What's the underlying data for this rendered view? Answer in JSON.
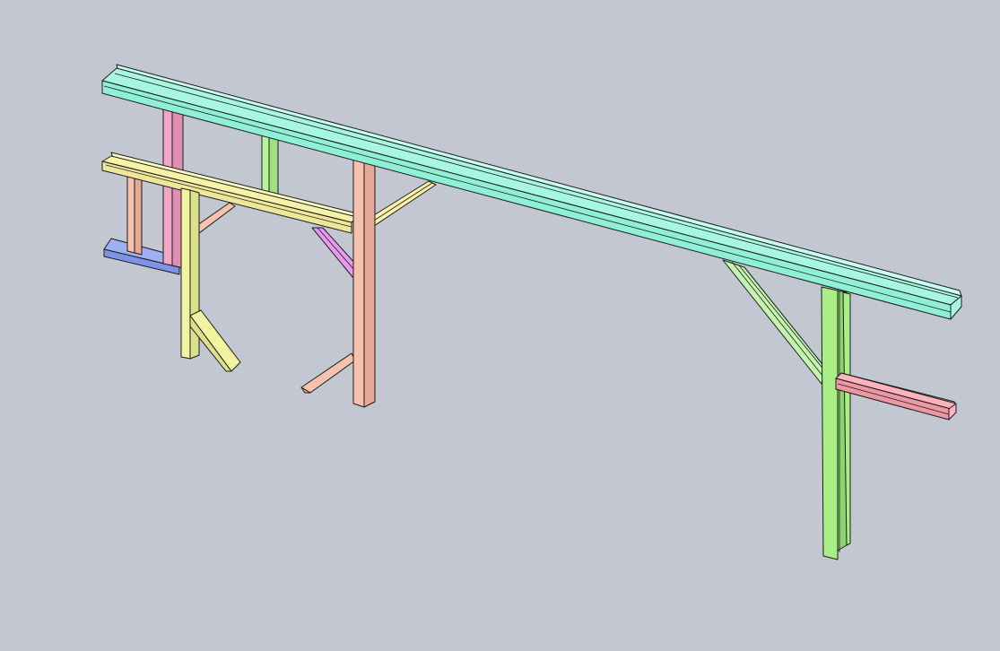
{
  "scene": {
    "background": "#c3c7d1",
    "outline": "#1c1c1c",
    "part_colors": {
      "top-rail": "#a6f6e2",
      "top-rail-face": "#8ff0d6",
      "top-rail-lip": "#c8fbef",
      "mid-rail": "#f8f2a8",
      "mid-rail-face": "#eee79a",
      "pink-post": "#f1a6c7",
      "green-post-short": "#b9f39b",
      "salmon-post": "#f6c2ae",
      "salmon-post-dark": "#e7a996",
      "yellow-post": "#f2f3a0",
      "yellow-post-dark": "#dbe08a",
      "blue-foot": "#7f93e6",
      "blue-foot-top": "#9fb0f1",
      "purple-brace": "#e59bf0",
      "green-brace": "#c4f4b0",
      "green-post-tall": "#a9ef86",
      "green-post-tall-dark": "#8cd56e",
      "red-arm": "#fcb3bd",
      "red-arm-dark": "#ec98a4"
    },
    "parts": [
      "top-rail",
      "mid-rail",
      "pink-post",
      "green-post-short",
      "salmon-post-left",
      "salmon-post-center",
      "yellow-post",
      "yellow-foot",
      "salmon-foot",
      "salmon-brace",
      "yellow-brace",
      "purple-brace",
      "blue-foot",
      "green-post-tall",
      "green-brace",
      "red-arm"
    ]
  }
}
